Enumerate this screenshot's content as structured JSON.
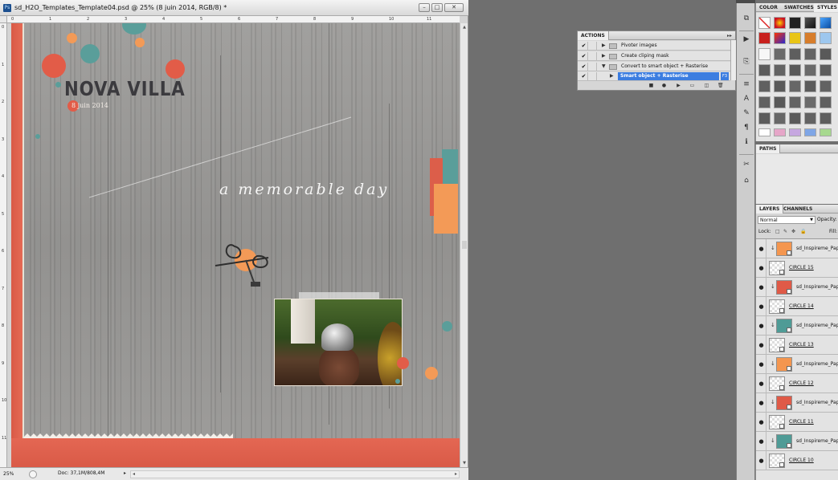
{
  "document": {
    "title": "sd_H2O_Templates_Template04.psd @ 25% (8 juin 2014, RGB/8) *",
    "ps_badge": "Ps",
    "zoom": "25%",
    "doc_size": "Doc: 37,1M/808,4M",
    "window_buttons": {
      "minimize": "–",
      "maximize": "□",
      "close": "✕"
    },
    "ruler_top": [
      "0",
      "1",
      "2",
      "3",
      "4",
      "5",
      "6",
      "7",
      "8",
      "9",
      "10",
      "11",
      "12"
    ],
    "ruler_left": [
      "0",
      "1",
      "2",
      "3",
      "4",
      "5",
      "6",
      "7",
      "8",
      "9",
      "10",
      "11"
    ]
  },
  "canvas": {
    "title": "NOVA VILLA",
    "date": "8 juin 2014",
    "script_caption": "a memorable day"
  },
  "actions_panel": {
    "tab_label": "ACTIONS",
    "menu_icon": "▸▸",
    "rows": [
      {
        "check": "✔",
        "label": "Pivoter images",
        "expand": "▶"
      },
      {
        "check": "✔",
        "label": "Create cliping mask",
        "expand": "▶"
      },
      {
        "check": "✔",
        "label": "Convert to smart object + Rasterise",
        "expand": "▼"
      },
      {
        "check": "✔",
        "label": "Smart object + Rasterise",
        "expand": "▶",
        "shortcut": "F3"
      }
    ],
    "toolbar_icons": [
      "stop-icon",
      "record-icon",
      "play-icon",
      "new-set-icon",
      "new-action-icon",
      "delete-icon"
    ]
  },
  "styles_panel": {
    "tabs": [
      "COLOR",
      "SWATCHES",
      "STYLES"
    ]
  },
  "paths_panel": {
    "tab_label": "PATHS"
  },
  "layers_panel": {
    "tabs": [
      "LAYERS",
      "CHANNELS"
    ],
    "blend_mode": "Normal",
    "opacity_label": "Opacity:",
    "lock_label": "Lock:",
    "fill_label": "Fill:",
    "layers": [
      {
        "name": "sd_Inspireme_Pape",
        "color": "#f4964f",
        "type": "paper"
      },
      {
        "name": "CIRCLE 15",
        "type": "shape"
      },
      {
        "name": "sd_Inspireme_Pape",
        "color": "#df5a47",
        "type": "paper"
      },
      {
        "name": "CIRCLE 14",
        "type": "shape"
      },
      {
        "name": "sd_Inspireme_Pape",
        "color": "#4f9b96",
        "type": "paper"
      },
      {
        "name": "CIRCLE 13",
        "type": "shape"
      },
      {
        "name": "sd_Inspireme_Pape",
        "color": "#f4964f",
        "type": "paper"
      },
      {
        "name": "CIRCLE 12",
        "type": "shape"
      },
      {
        "name": "sd_Inspireme_Pape",
        "color": "#df5a47",
        "type": "paper"
      },
      {
        "name": "CIRCLE 11",
        "type": "shape"
      },
      {
        "name": "sd_Inspireme_Pape",
        "color": "#4f9b96",
        "type": "paper"
      },
      {
        "name": "CIRCLE 10",
        "type": "shape"
      }
    ]
  },
  "colors": {
    "coral": "#df5a47",
    "orange": "#f4964f",
    "teal": "#4f9b96",
    "selection_blue": "#3b7de0"
  }
}
